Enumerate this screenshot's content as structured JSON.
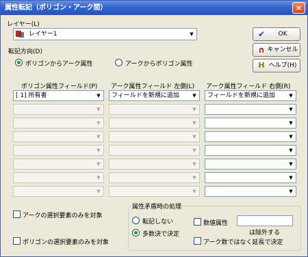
{
  "window": {
    "title": "属性転記（ポリゴン・アーク間）",
    "close": "×"
  },
  "layer": {
    "label": "レイヤー(L)",
    "value": "レイヤー1"
  },
  "direction": {
    "label": "転記方向(D)",
    "opt1": "ポリゴンからアーク属性",
    "opt2": "アークからポリゴン属性",
    "selected": "opt1"
  },
  "buttons": {
    "ok": "OK",
    "cancel": "キャンセル",
    "help": "ヘルプ(H)"
  },
  "columns": {
    "polygon": "ポリゴン属性フィールド(P)",
    "left": "アーク属性フィールド 左側(L)",
    "right": "アーク属性フィールド 右側(R)"
  },
  "rows": [
    {
      "polygon": "[ 1] 所有者",
      "left": "フィールドを新規に追加",
      "right": "フィールドを新規に追加"
    },
    {
      "polygon": "",
      "left": "",
      "right": ""
    },
    {
      "polygon": "",
      "left": "",
      "right": ""
    },
    {
      "polygon": "",
      "left": "",
      "right": ""
    },
    {
      "polygon": "",
      "left": "",
      "right": ""
    },
    {
      "polygon": "",
      "left": "",
      "right": ""
    },
    {
      "polygon": "",
      "left": "",
      "right": ""
    },
    {
      "polygon": "",
      "left": "",
      "right": ""
    }
  ],
  "options": {
    "arc_selected_only": "アークの選択要素のみを対象",
    "polygon_selected_only": "ポリゴンの選択要素のみを対象"
  },
  "conflict": {
    "title": "属性矛盾時の処理",
    "no_transfer": "転記しない",
    "majority": "多数決で決定",
    "selected": "majority",
    "numeric_attr": "数値属性",
    "numeric_value": "",
    "exclude": "は除外する",
    "by_count": "アーク数ではなく延長で決定"
  }
}
